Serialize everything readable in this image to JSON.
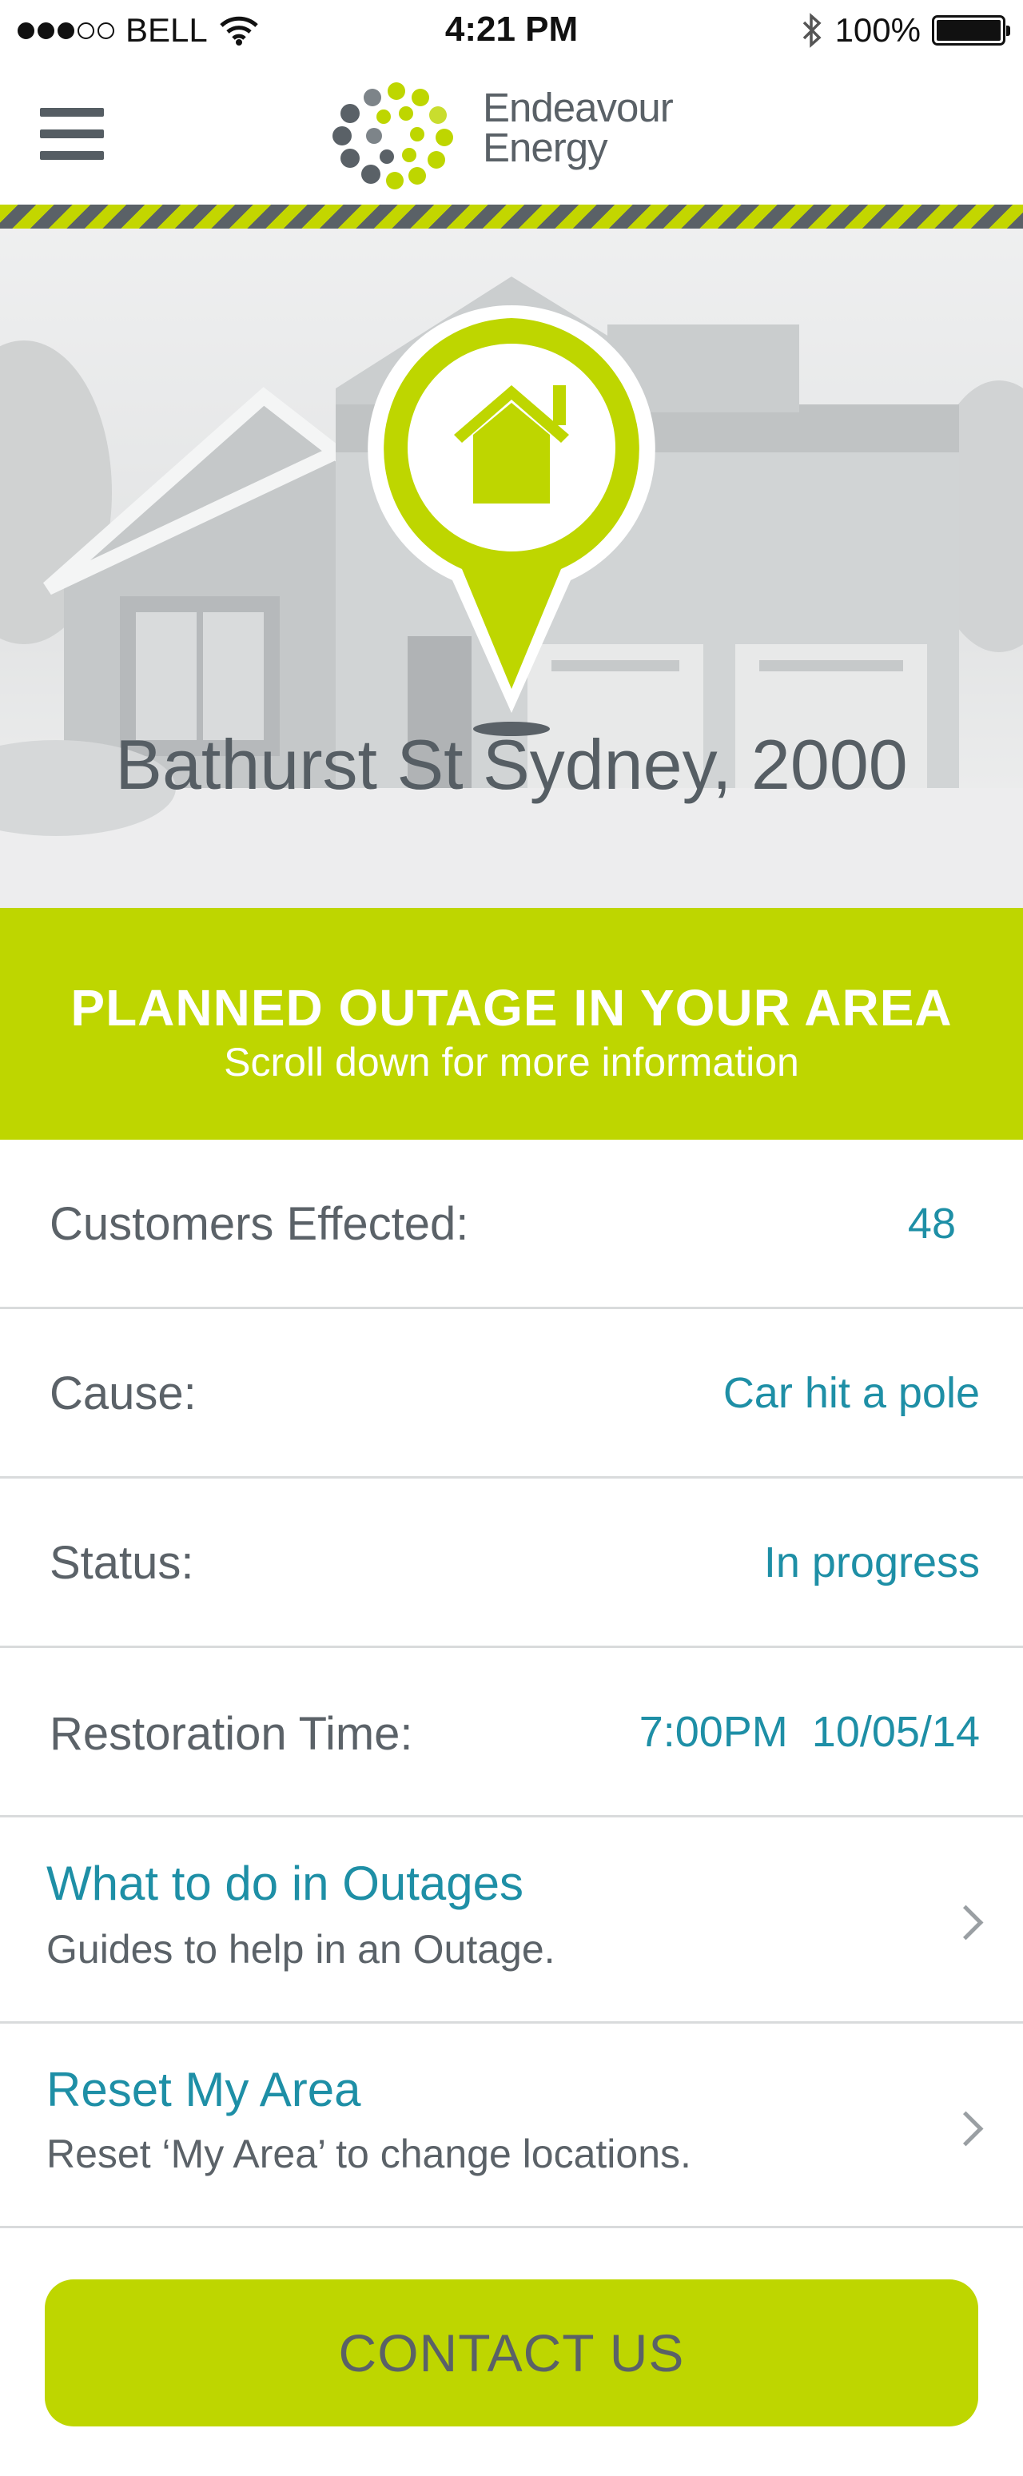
{
  "status_bar": {
    "carrier": "BELL",
    "time": "4:21 PM",
    "battery": "100%",
    "signal_bars": 3,
    "signal_total": 5
  },
  "header": {
    "logo_line1": "Endeavour",
    "logo_line2": "Energy",
    "menu_icon": "hamburger-icon"
  },
  "hero": {
    "address": "Bathurst St Sydney, 2000",
    "pin_icon": "home-icon"
  },
  "banner": {
    "title": "PLANNED OUTAGE IN YOUR AREA",
    "subtitle": "Scroll down for more information"
  },
  "details": [
    {
      "label": "Customers Effected:",
      "value": "48"
    },
    {
      "label": "Cause:",
      "value": "Car hit a pole"
    },
    {
      "label": "Status:",
      "value": "In progress"
    },
    {
      "label": "Restoration Time:",
      "value": "7:00PM  10/05/14"
    }
  ],
  "links": [
    {
      "title": "What to do in Outages",
      "subtitle": "Guides to help in an Outage."
    },
    {
      "title": "Reset My Area",
      "subtitle": "Reset ‘My Area’ to change locations."
    }
  ],
  "contact_button": "CONTACT US",
  "colors": {
    "brand_green": "#bed600",
    "brand_grey": "#5a6167",
    "value_blue": "#1e8fa6"
  }
}
